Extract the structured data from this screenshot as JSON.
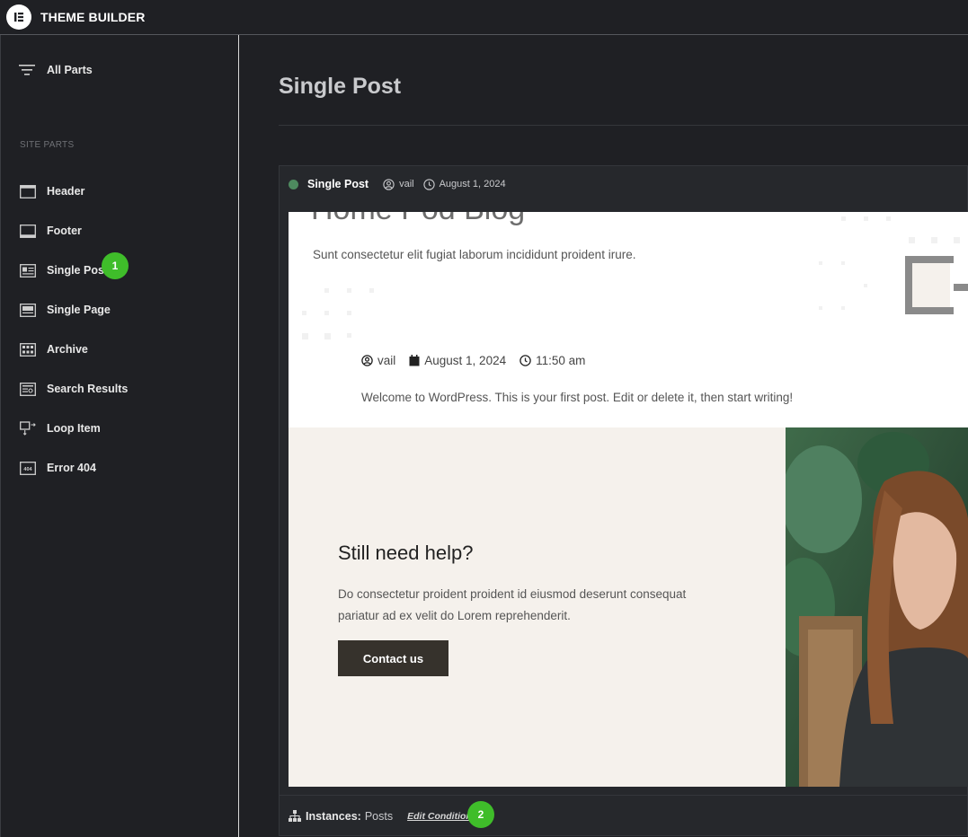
{
  "app": {
    "title": "THEME BUILDER"
  },
  "sidebar": {
    "all_parts_label": "All Parts",
    "section_label": "SITE PARTS",
    "items": [
      {
        "label": "Header",
        "icon": "header-icon"
      },
      {
        "label": "Footer",
        "icon": "footer-icon"
      },
      {
        "label": "Single Post",
        "icon": "single-post-icon"
      },
      {
        "label": "Single Page",
        "icon": "single-page-icon"
      },
      {
        "label": "Archive",
        "icon": "archive-icon"
      },
      {
        "label": "Search Results",
        "icon": "search-results-icon"
      },
      {
        "label": "Loop Item",
        "icon": "loop-item-icon"
      },
      {
        "label": "Error 404",
        "icon": "error-404-icon"
      }
    ]
  },
  "badges": {
    "one": "1",
    "two": "2"
  },
  "main": {
    "page_title": "Single Post",
    "card": {
      "title": "Single Post",
      "author": "vail",
      "date": "August 1, 2024",
      "status_color": "#4e8a5f"
    },
    "preview": {
      "hero_subtitle": "Sunt consectetur elit fugiat laborum incididunt proident irure.",
      "author": "vail",
      "date": "August 1, 2024",
      "time": "11:50 am",
      "welcome": "Welcome to WordPress. This is your first post. Edit or delete it, then start writing!",
      "help_title": "Still need help?",
      "help_body": "Do consectetur proident proident id eiusmod deserunt consequat pariatur ad ex velit do Lorem reprehenderit.",
      "contact_label": "Contact us"
    },
    "footer": {
      "instances_label": "Instances:",
      "instances_value": "Posts",
      "edit_conditions": "Edit Conditions"
    }
  },
  "colors": {
    "accent_badge": "#3fbd2a",
    "bg": "#1f2024",
    "button": "#36322c",
    "help_bg": "#f5f1ec"
  }
}
